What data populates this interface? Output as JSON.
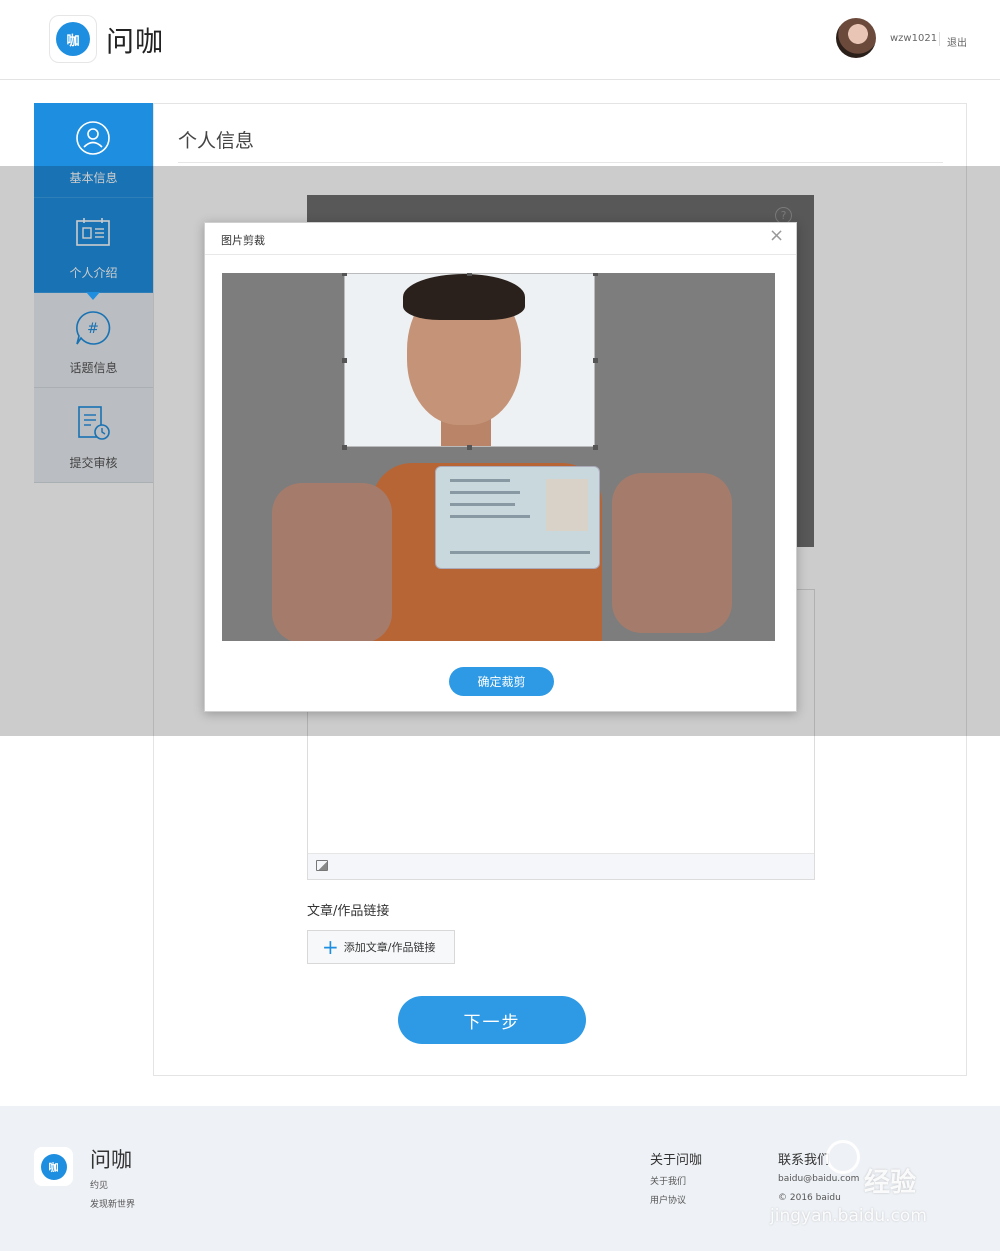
{
  "header": {
    "logo_text": "咖",
    "app_name": "问咖",
    "username": "wzw1021",
    "logout_label": "退出"
  },
  "sidebar": {
    "items": [
      {
        "label": "基本信息",
        "icon": "user-icon",
        "active": true
      },
      {
        "label": "个人介绍",
        "icon": "id-card-icon",
        "active": true
      },
      {
        "label": "话题信息",
        "icon": "topic-hash-icon",
        "active": false
      },
      {
        "label": "提交审核",
        "icon": "review-doc-icon",
        "active": false
      }
    ]
  },
  "main": {
    "title": "个人信息",
    "help_label": "?",
    "links_label": "文章/作品链接",
    "add_link_label": "添加文章/作品链接",
    "next_label": "下一步"
  },
  "dialog": {
    "title": "图片剪裁",
    "close_label": "×",
    "confirm_label": "确定裁剪"
  },
  "footer": {
    "logo_text": "咖",
    "app_name": "问咖",
    "slogan_line1": "约见",
    "slogan_line2": "发现新世界",
    "about_heading": "关于问咖",
    "about_us": "关于我们",
    "user_agreement": "用户协议",
    "contact_heading": "联系我们",
    "contact_email": "baidu@baidu.com",
    "copyright": "© 2016 baidu"
  },
  "watermark": {
    "brand": "经验",
    "url": "jingyan.baidu.com"
  },
  "colors": {
    "accent": "#1e8fe0",
    "button": "#2e9ae5",
    "footer_bg": "#eef1f5"
  }
}
